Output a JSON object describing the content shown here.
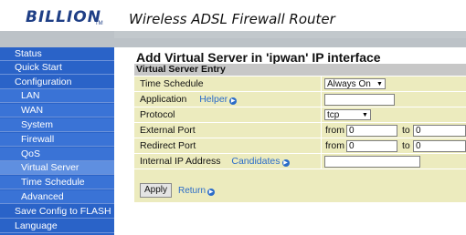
{
  "header": {
    "brand": "BILLION",
    "brand_tm": "TM",
    "product_title": "Wireless ADSL Firewall Router"
  },
  "sidebar": {
    "items": [
      {
        "label": "Status",
        "level": 0
      },
      {
        "label": "Quick Start",
        "level": 0
      },
      {
        "label": "Configuration",
        "level": 0
      },
      {
        "label": "LAN",
        "level": 1
      },
      {
        "label": "WAN",
        "level": 1
      },
      {
        "label": "System",
        "level": 1
      },
      {
        "label": "Firewall",
        "level": 1
      },
      {
        "label": "QoS",
        "level": 1
      },
      {
        "label": "Virtual Server",
        "level": 1,
        "active": true
      },
      {
        "label": "Time Schedule",
        "level": 1
      },
      {
        "label": "Advanced",
        "level": 1
      },
      {
        "label": "Save Config to FLASH",
        "level": 0
      },
      {
        "label": "Language",
        "level": 0
      }
    ]
  },
  "main": {
    "title": "Add Virtual Server in 'ipwan' IP interface",
    "section_title": "Virtual Server Entry",
    "fields": {
      "time_schedule": {
        "label": "Time Schedule",
        "value": "Always On"
      },
      "application": {
        "label": "Application",
        "helper_link": "Helper",
        "value": ""
      },
      "protocol": {
        "label": "Protocol",
        "value": "tcp"
      },
      "external_port": {
        "label": "External Port",
        "from_label": "from",
        "from_value": "0",
        "to_label": "to",
        "to_value": "0"
      },
      "redirect_port": {
        "label": "Redirect Port",
        "from_label": "from",
        "from_value": "0",
        "to_label": "to",
        "to_value": "0"
      },
      "internal_ip": {
        "label": "Internal IP Address",
        "candidates_link": "Candidates",
        "value": ""
      }
    },
    "buttons": {
      "apply": "Apply",
      "return": "Return"
    }
  },
  "colors": {
    "sidebar_bg": "#2a63c8",
    "table_bg": "#ecebbe",
    "section_bg": "#c7c7c7",
    "link": "#2b6cc8"
  },
  "icons": {
    "link_arrow": "arrow-circle-icon",
    "dropdown": "chevron-down-icon"
  }
}
